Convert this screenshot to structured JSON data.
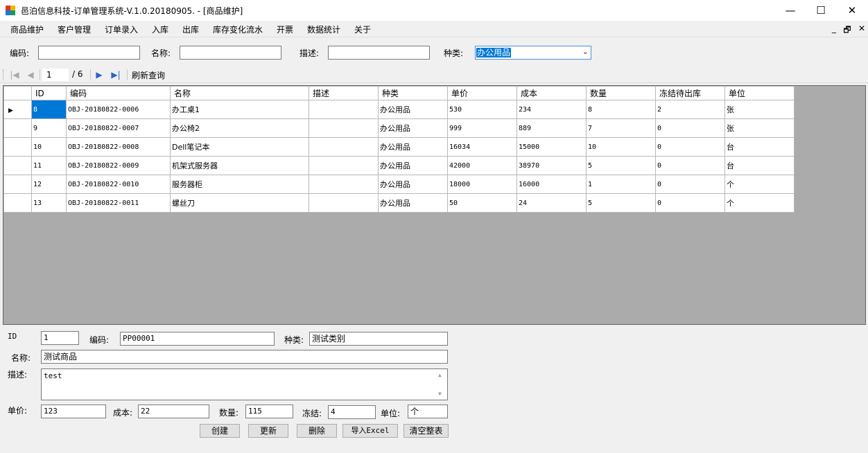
{
  "window": {
    "title": "邑泊信息科技-订单管理系统-V.1.0.20180905. - [商品维护]",
    "minimize": "—",
    "maximize": "☐",
    "close": "✕"
  },
  "menu": {
    "items": [
      "商品维护",
      "客户管理",
      "订单录入",
      "入库",
      "出库",
      "库存变化流水",
      "开票",
      "数据统计",
      "关于"
    ],
    "mdi_minimize": "_",
    "mdi_restore": "🗗",
    "mdi_close": "✕"
  },
  "filter": {
    "code_label": "编码:",
    "code_value": "",
    "name_label": "名称:",
    "name_value": "",
    "desc_label": "描述:",
    "desc_value": "",
    "category_label": "种类:",
    "category_value": "办公用品"
  },
  "navigator": {
    "position": "1",
    "count": "/ 6",
    "refresh_label": "刷新查询"
  },
  "grid": {
    "columns": [
      "ID",
      "编码",
      "名称",
      "描述",
      "种类",
      "单价",
      "成本",
      "数量",
      "冻结待出库",
      "单位"
    ],
    "rows": [
      [
        "8",
        "OBJ-20180822-0006",
        "办工桌1",
        "",
        "办公用品",
        "530",
        "234",
        "8",
        "2",
        "张"
      ],
      [
        "9",
        "OBJ-20180822-0007",
        "办公椅2",
        "",
        "办公用品",
        "999",
        "889",
        "7",
        "0",
        "张"
      ],
      [
        "10",
        "OBJ-20180822-0008",
        "Dell笔记本",
        "",
        "办公用品",
        "16034",
        "15000",
        "10",
        "0",
        "台"
      ],
      [
        "11",
        "OBJ-20180822-0009",
        "机架式服务器",
        "",
        "办公用品",
        "42000",
        "38970",
        "5",
        "0",
        "台"
      ],
      [
        "12",
        "OBJ-20180822-0010",
        "服务器柜",
        "",
        "办公用品",
        "18000",
        "16000",
        "1",
        "0",
        "个"
      ],
      [
        "13",
        "OBJ-20180822-0011",
        "螺丝刀",
        "",
        "办公用品",
        "50",
        "24",
        "5",
        "0",
        "个"
      ]
    ]
  },
  "detail": {
    "id_label": "ID",
    "id_value": "1",
    "code_label": "编码:",
    "code_value": "PP00001",
    "category_label": "种类:",
    "category_value": "测试类别",
    "name_label": "名称:",
    "name_value": "测试商品",
    "desc_label": "描述:",
    "desc_value": "test",
    "price_label": "单价:",
    "price_value": "123",
    "cost_label": "成本:",
    "cost_value": "22",
    "qty_label": "数量:",
    "qty_value": "115",
    "frozen_label": "冻结:",
    "frozen_value": "4",
    "unit_label": "单位:",
    "unit_value": "个"
  },
  "buttons": {
    "create": "创建",
    "update": "更新",
    "delete": "删除",
    "import_excel": "导入Excel",
    "clear_table": "清空整表"
  }
}
